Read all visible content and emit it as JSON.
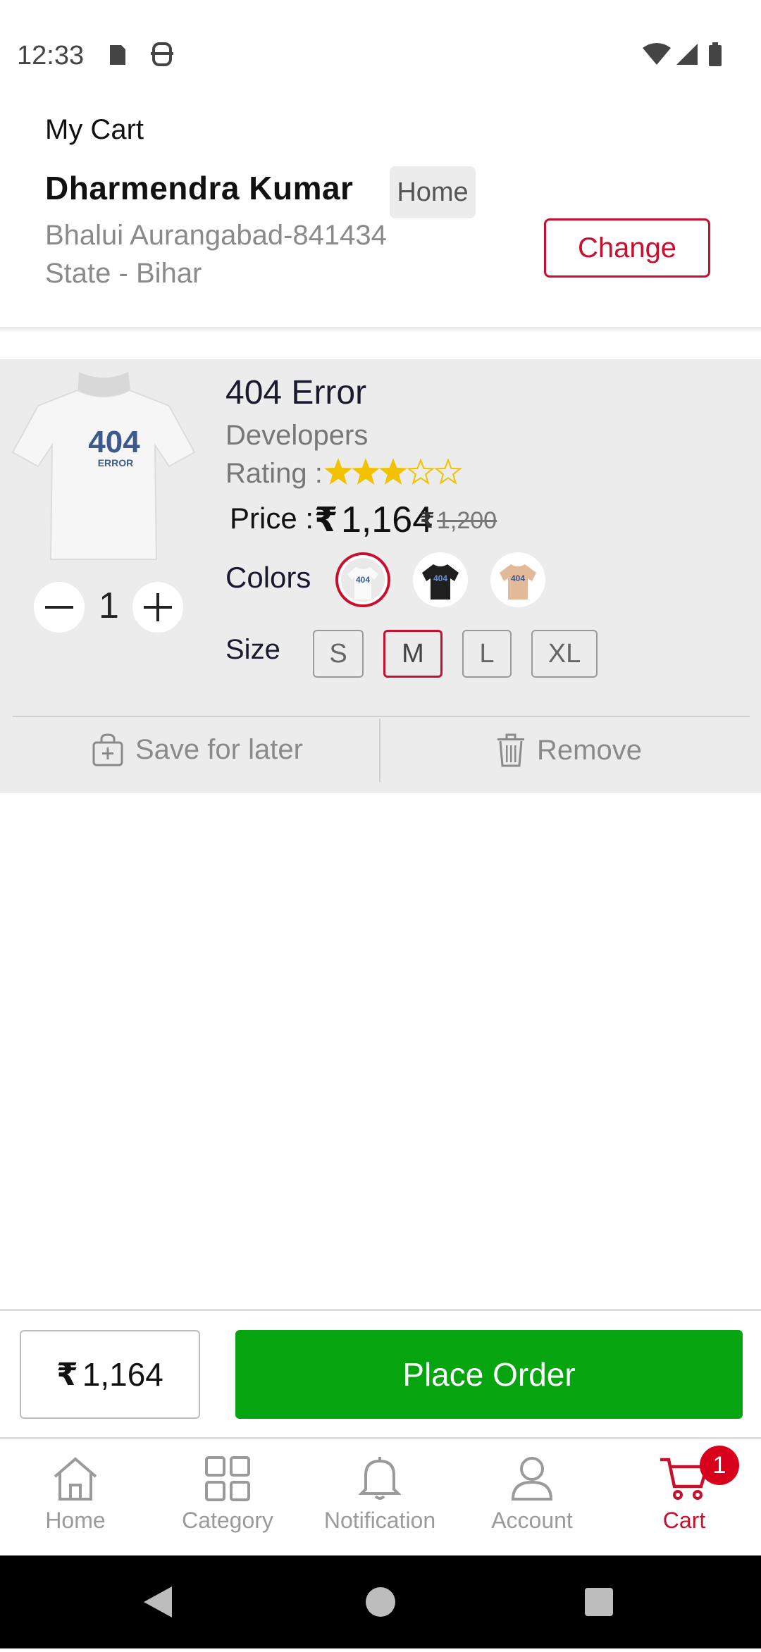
{
  "status_bar": {
    "time": "12:33"
  },
  "header": {
    "title": "My Cart",
    "customer_name": "Dharmendra Kumar",
    "address_tag": "Home",
    "address_line1": "Bhalui Aurangabad-841434",
    "address_line2": "State - Bihar",
    "change_label": "Change"
  },
  "item": {
    "title": "404 Error",
    "brand": "Developers",
    "rating_label": "Rating :",
    "rating": 3,
    "rating_max": 5,
    "price_label": "Price :",
    "currency": "₹",
    "price": "1,164",
    "mrp": "1,200",
    "quantity": "1",
    "colors_label": "Colors",
    "colors": [
      "white",
      "black",
      "beige"
    ],
    "selected_color": "white",
    "size_label": "Size",
    "sizes": [
      "S",
      "M",
      "L",
      "XL"
    ],
    "selected_size": "M",
    "save_later_label": "Save for later",
    "remove_label": "Remove",
    "print_text_big": "404",
    "print_text_small": "ERROR"
  },
  "footer": {
    "total": "1,164",
    "place_order_label": "Place Order"
  },
  "nav": {
    "items": [
      {
        "label": "Home",
        "icon": "home-icon"
      },
      {
        "label": "Category",
        "icon": "grid-icon"
      },
      {
        "label": "Notification",
        "icon": "bell-icon"
      },
      {
        "label": "Account",
        "icon": "user-icon"
      },
      {
        "label": "Cart",
        "icon": "cart-icon"
      }
    ],
    "cart_badge": "1",
    "active": "Cart"
  },
  "colors": {
    "accent": "#c8102e",
    "place_order": "#05a50f",
    "star": "#f2c200"
  }
}
